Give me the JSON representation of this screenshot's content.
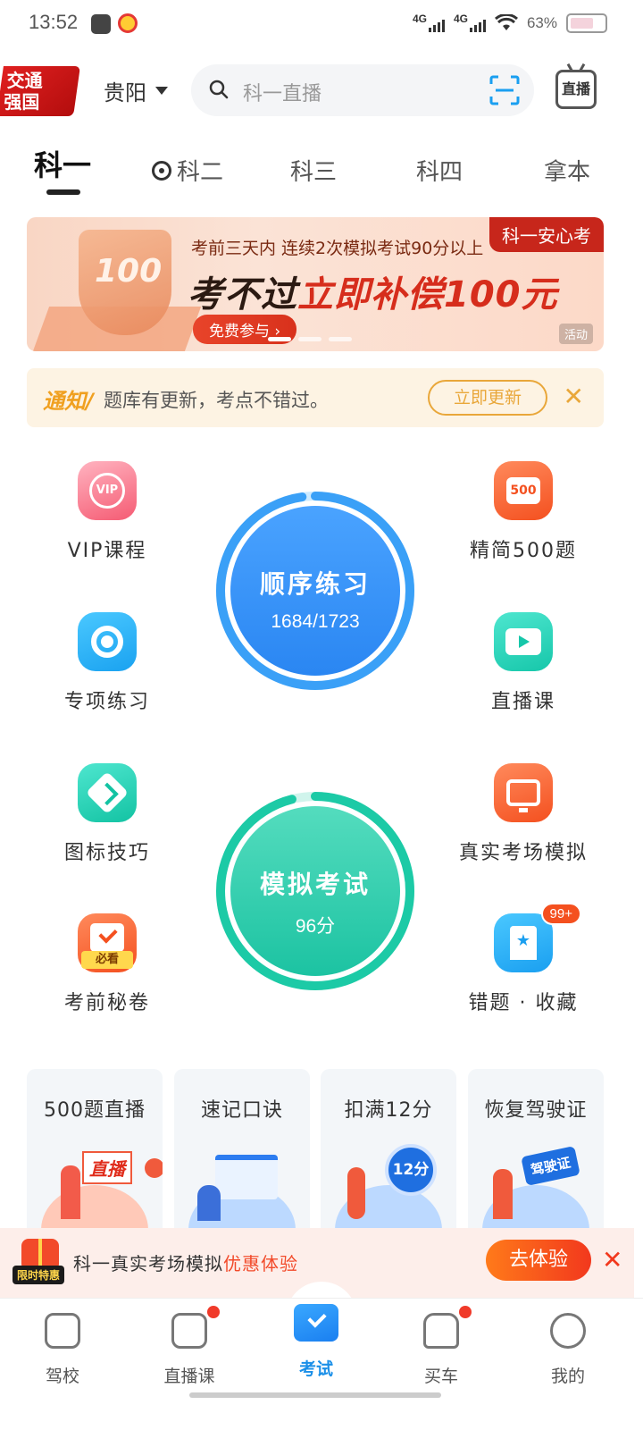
{
  "status": {
    "time": "13:52",
    "net1": "4G",
    "net2": "4G",
    "battery": "63%"
  },
  "header": {
    "logo_line1": "交通",
    "logo_line2": "强国",
    "city": "贵阳",
    "search_placeholder": "科一直播",
    "live_label": "直播"
  },
  "tabs": [
    "科一",
    "科二",
    "科三",
    "科四",
    "拿本"
  ],
  "banner": {
    "tag": "科一安心考",
    "shield_text": "100",
    "line1": "考前三天内 连续2次模拟考试90分以上",
    "line2_a": "考不过",
    "line2_b": "立即补偿100元",
    "cta": "免费参与 ›",
    "activity": "活动"
  },
  "notice": {
    "tag": "通知/",
    "text": "题库有更新，考点不错过。",
    "button": "立即更新",
    "close": "✕"
  },
  "left_items": [
    "VIP课程",
    "专项练习",
    "图标技巧",
    "考前秘卷"
  ],
  "right_items": [
    "精简500题",
    "直播课",
    "真实考场模拟",
    "错题 · 收藏"
  ],
  "icons": {
    "vip_text": "VIP",
    "five_hundred": "500",
    "must_watch": "必看",
    "star": "★",
    "badge": "99+"
  },
  "practice": {
    "title": "顺序练习",
    "progress": "1684/1723",
    "done": 1684,
    "total": 1723
  },
  "exam": {
    "title": "模拟考试",
    "score": "96分",
    "score_value": 96
  },
  "cards": [
    {
      "title": "500题直播",
      "deco": "直播"
    },
    {
      "title": "速记口诀",
      "deco": ""
    },
    {
      "title": "扣满12分",
      "deco": "12分"
    },
    {
      "title": "恢复驾驶证",
      "deco": "驾驶证"
    }
  ],
  "promo": {
    "tag": "限时特惠",
    "text_a": "科一真实考场模拟",
    "text_b": "优惠体验",
    "button": "去体验",
    "close": "✕"
  },
  "nav": [
    "驾校",
    "直播课",
    "考试",
    "买车",
    "我的"
  ],
  "colors": {
    "accent": "#1a8fe8",
    "orange": "#f4501f",
    "green": "#16c7aa"
  }
}
